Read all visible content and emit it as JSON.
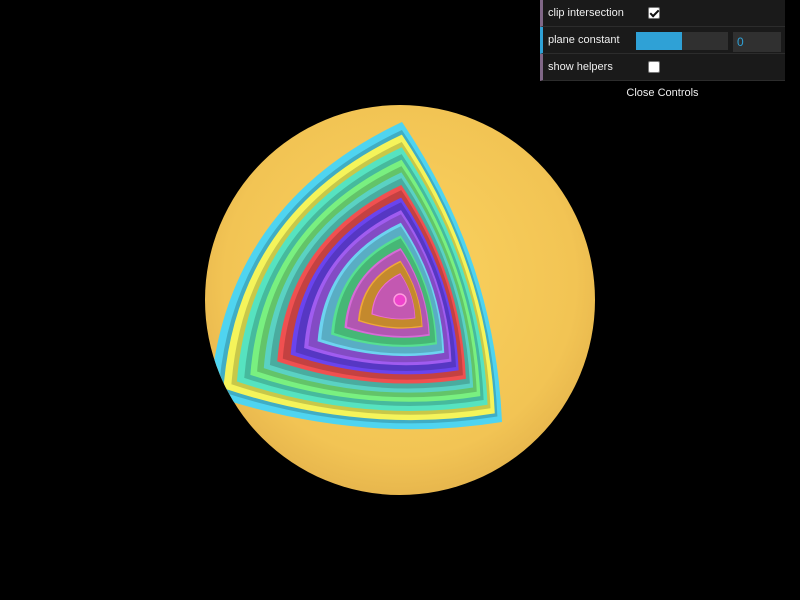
{
  "controls": {
    "clip_intersection": {
      "label": "clip intersection",
      "checked": true
    },
    "plane_constant": {
      "label": "plane constant",
      "value": "0",
      "fraction": 0.5
    },
    "show_helpers": {
      "label": "show helpers",
      "checked": false
    },
    "close_label": "Close Controls"
  },
  "colors": {
    "background": "#000000",
    "outer_sphere": "#f2c454",
    "slider_accent": "#2fa1d6",
    "bool_accent": "#806787"
  },
  "scene": {
    "rings": [
      "#4fd4f0",
      "#f5f45a",
      "#56e3c0",
      "#79f080",
      "#5ad2c3",
      "#f05050",
      "#6a44ee",
      "#a05cf0",
      "#6dd3f0",
      "#56e090",
      "#d86ad8",
      "#f0a838",
      "#ee6cd8"
    ]
  }
}
